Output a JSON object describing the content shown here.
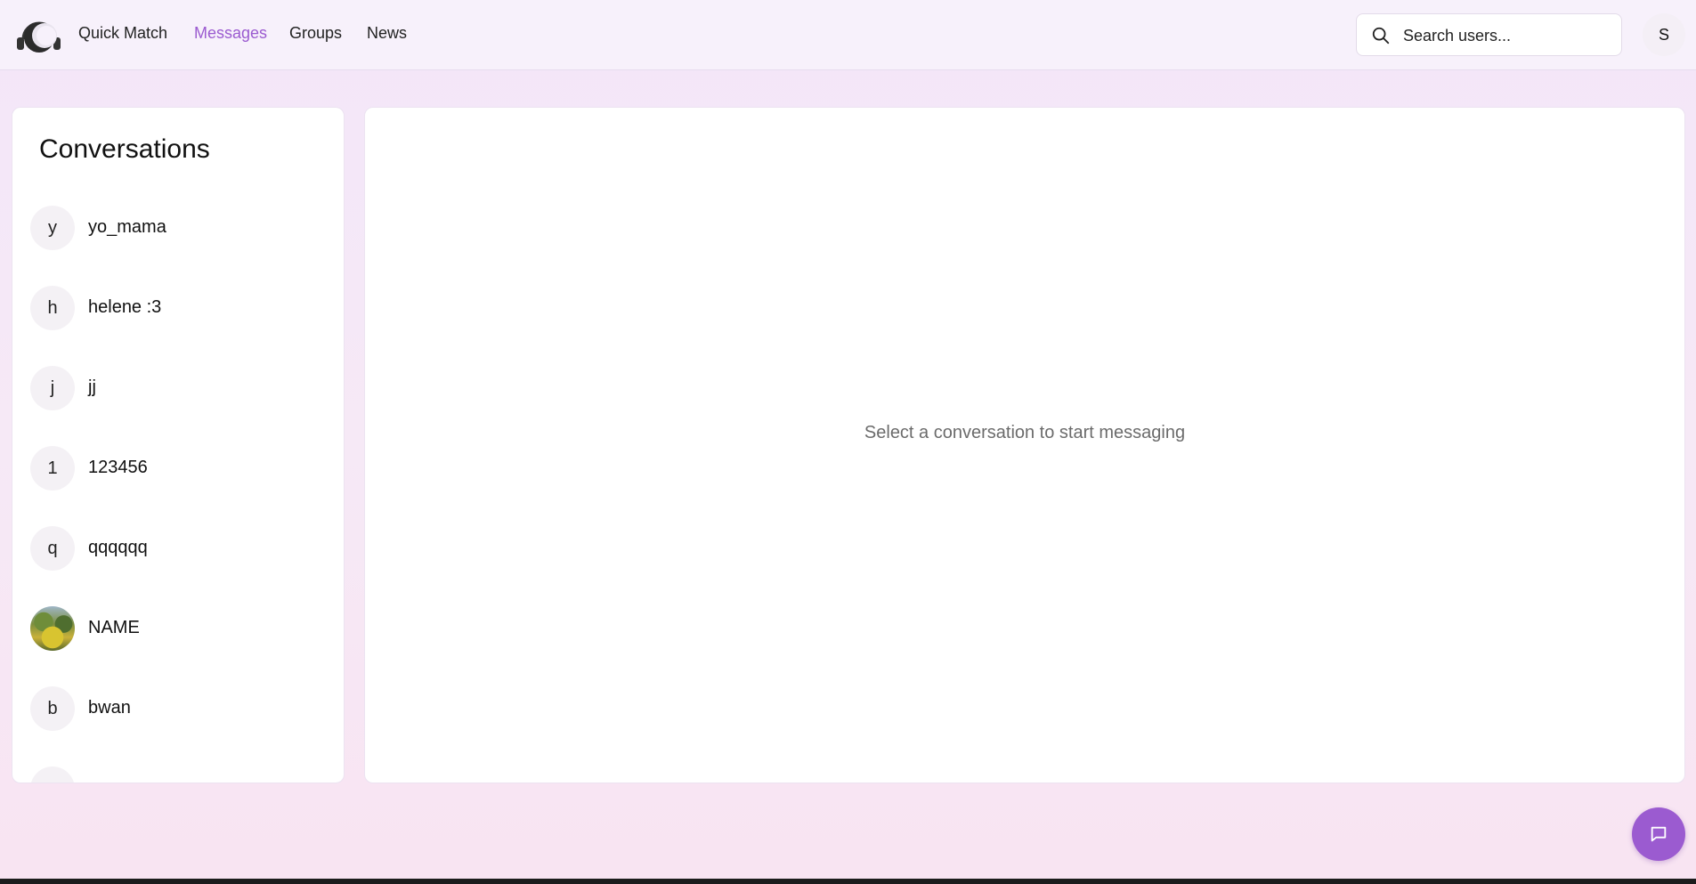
{
  "header": {
    "logo_icon": "headphones-moon-logo",
    "nav": [
      {
        "label": "Quick Match",
        "active": false
      },
      {
        "label": "Messages",
        "active": true
      },
      {
        "label": "Groups",
        "active": false
      },
      {
        "label": "News",
        "active": false
      }
    ],
    "search": {
      "placeholder": "Search users...",
      "value": "",
      "icon": "search-icon"
    },
    "user_initial": "S"
  },
  "sidebar": {
    "title": "Conversations",
    "items": [
      {
        "avatar": "y",
        "name": "yo_mama"
      },
      {
        "avatar": "h",
        "name": "helene :3"
      },
      {
        "avatar": "j",
        "name": "jj"
      },
      {
        "avatar": "1",
        "name": "123456"
      },
      {
        "avatar": "q",
        "name": "qqqqqq"
      },
      {
        "avatar": "",
        "name": "NAME",
        "avatar_type": "photo"
      },
      {
        "avatar": "b",
        "name": "bwan"
      }
    ]
  },
  "main": {
    "empty_message": "Select a conversation to start messaging"
  },
  "fab": {
    "icon": "chat-bubble-icon"
  },
  "colors": {
    "accent": "#9b5bd0",
    "panel": "#ffffff",
    "background": "#f3e6f9"
  }
}
